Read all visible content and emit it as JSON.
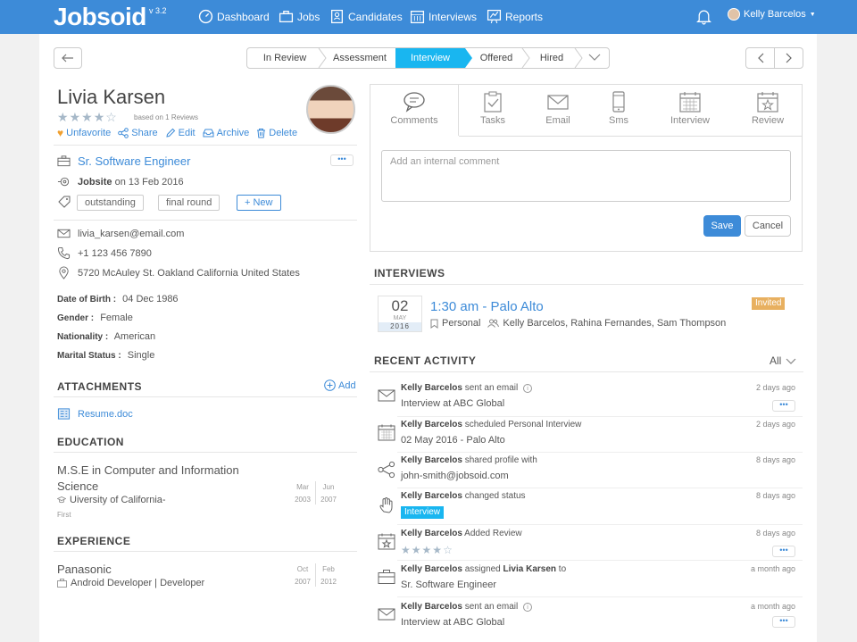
{
  "app": {
    "brand": "Jobsoid",
    "version": "v 3.2"
  },
  "nav": {
    "dashboard": "Dashboard",
    "jobs": "Jobs",
    "candidates": "Candidates",
    "interviews": "Interviews",
    "reports": "Reports",
    "user": "Kelly Barcelos"
  },
  "stages": [
    "In Review",
    "Assessment",
    "Interview",
    "Offered",
    "Hired"
  ],
  "active_stage": "Interview",
  "candidate": {
    "name": "Livia Karsen",
    "rating": 4,
    "reviews_note": "based on 1 Reviews",
    "actions": {
      "unfavorite": "Unfavorite",
      "share": "Share",
      "edit": "Edit",
      "archive": "Archive",
      "delete": "Delete"
    },
    "job_title": "Sr. Software Engineer",
    "source": "Jobsite",
    "source_date": "on 13 Feb 2016",
    "tags": [
      "outstanding",
      "final round"
    ],
    "new_tag": "+ New",
    "email": "livia_karsen@email.com",
    "phone": "+1 123 456 7890",
    "address": "5720 McAuley St. Oakland California United States",
    "dob_label": "Date of Birth :",
    "dob": "04 Dec 1986",
    "gender_label": "Gender :",
    "gender": "Female",
    "nationality_label": "Nationality :",
    "nationality": "American",
    "marital_label": "Marital Status :",
    "marital": "Single"
  },
  "attachments": {
    "title": "ATTACHMENTS",
    "add": "Add",
    "file": "Resume.doc"
  },
  "education": {
    "title": "EDUCATION",
    "degree": "M.S.E in Computer and Information Science",
    "school": "Uiversity of California-",
    "note": "First",
    "from_m": "Mar",
    "from_y": "2003",
    "to_m": "Jun",
    "to_y": "2007"
  },
  "experience": {
    "title": "EXPERIENCE",
    "company": "Panasonic",
    "role": "Android Developer | Developer",
    "from_m": "Oct",
    "from_y": "2007",
    "to_m": "Feb",
    "to_y": "2012"
  },
  "tabs": [
    "Comments",
    "Tasks",
    "Email",
    "Sms",
    "Interview",
    "Review"
  ],
  "comment": {
    "placeholder": "Add an internal comment",
    "save": "Save",
    "cancel": "Cancel"
  },
  "interviews": {
    "title": "INTERVIEWS",
    "day": "02",
    "month": "MAY",
    "year": "2016",
    "heading": "1:30 am - Palo Alto",
    "type": "Personal",
    "participants": "Kelly Barcelos, Rahina Fernandes, Sam Thompson",
    "status": "Invited"
  },
  "activity": {
    "title": "RECENT ACTIVITY",
    "filter": "All",
    "items": [
      {
        "actor": "Kelly Barcelos",
        "action": "sent an email",
        "detail": "Interview at ABC Global",
        "time": "2 days ago"
      },
      {
        "actor": "Kelly Barcelos",
        "action": "scheduled Personal Interview",
        "detail": "02 May 2016 - Palo Alto",
        "time": "2 days ago"
      },
      {
        "actor": "Kelly Barcelos",
        "action": "shared profile with",
        "detail": "john-smith@jobsoid.com",
        "time": "8 days ago"
      },
      {
        "actor": "Kelly Barcelos",
        "action": "changed status",
        "detail": "Interview",
        "time": "8 days ago"
      },
      {
        "actor": "Kelly Barcelos",
        "action": "Added Review",
        "detail": "",
        "time": "8 days ago"
      },
      {
        "actor": "Kelly Barcelos",
        "action": "assigned",
        "target": "Livia Karsen",
        "suffix": "to",
        "detail": "Sr. Software Engineer",
        "time": "a month ago"
      },
      {
        "actor": "Kelly Barcelos",
        "action": "sent an email",
        "detail": "Interview at ABC Global",
        "time": "a month ago"
      }
    ]
  },
  "colors": {
    "primary": "#3d8bd8",
    "active_stage": "#19b6f0",
    "invited": "#e8b060"
  }
}
